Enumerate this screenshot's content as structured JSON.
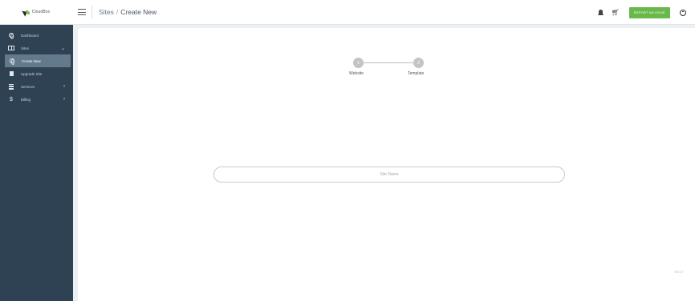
{
  "brand": {
    "name": "CloudBox"
  },
  "header": {
    "breadcrumb_root": "Sites",
    "breadcrumb_sep": "/",
    "breadcrumb_current": "Create New",
    "report_button": "REPORT AN ISSUE"
  },
  "sidebar": {
    "items": [
      {
        "label": "Dashboard",
        "icon": "globe-icon"
      },
      {
        "label": "Sites",
        "icon": "sites-icon",
        "chevron": "⌄"
      },
      {
        "label": "Create New",
        "icon": "globe-icon"
      },
      {
        "label": "Upgrade Site",
        "icon": "document-icon"
      },
      {
        "label": "Services",
        "icon": "server-icon",
        "chevron": "›"
      },
      {
        "label": "Billing",
        "icon": "dollar-icon",
        "chevron": "›"
      }
    ]
  },
  "wizard": {
    "steps": [
      {
        "number": "1",
        "label": "Website"
      },
      {
        "number": "2",
        "label": "Template"
      }
    ],
    "site_name_placeholder": "Site Name",
    "next_label": "NEXT"
  }
}
